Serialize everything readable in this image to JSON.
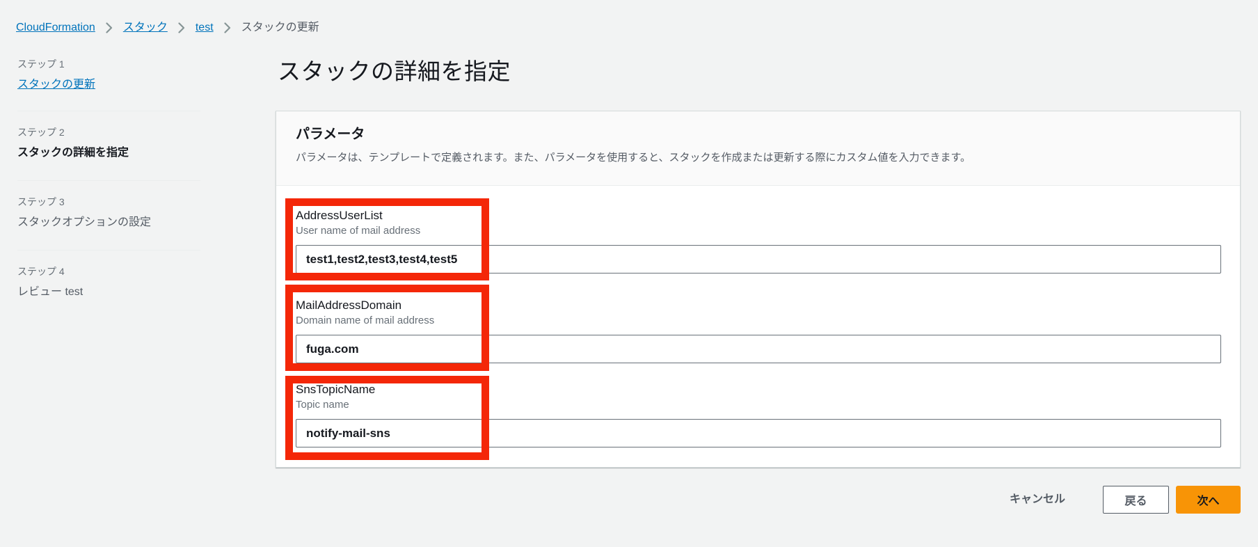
{
  "breadcrumb": {
    "items": [
      {
        "label": "CloudFormation"
      },
      {
        "label": "スタック"
      },
      {
        "label": "test"
      }
    ],
    "current": "スタックの更新"
  },
  "icons": {
    "breadcrumb_separator": "chevron-right"
  },
  "steps": [
    {
      "step_label": "ステップ 1",
      "title": "スタックの更新"
    },
    {
      "step_label": "ステップ 2",
      "title": "スタックの詳細を指定"
    },
    {
      "step_label": "ステップ 3",
      "title": "スタックオプションの設定"
    },
    {
      "step_label": "ステップ 4",
      "title": "レビュー test"
    }
  ],
  "page": {
    "title": "スタックの詳細を指定"
  },
  "panel": {
    "title": "パラメータ",
    "description": "パラメータは、テンプレートで定義されます。また、パラメータを使用すると、スタックを作成または更新する際にカスタム値を入力できます。"
  },
  "parameters": [
    {
      "name": "AddressUserList",
      "description": "User name of mail address",
      "value": "test1,test2,test3,test4,test5"
    },
    {
      "name": "MailAddressDomain",
      "description": "Domain name of mail address",
      "value": "fuga.com"
    },
    {
      "name": "SnsTopicName",
      "description": "Topic name",
      "value": "notify-mail-sns"
    }
  ],
  "footer": {
    "cancel_label": "キャンセル",
    "back_label": "戻る",
    "next_label": "次へ"
  },
  "colors": {
    "link_blue": "#0073bb",
    "primary_button_orange": "#f89406",
    "annotation_red": "#f42708",
    "page_background": "#f2f3f3",
    "panel_header_background": "#fafafa"
  }
}
